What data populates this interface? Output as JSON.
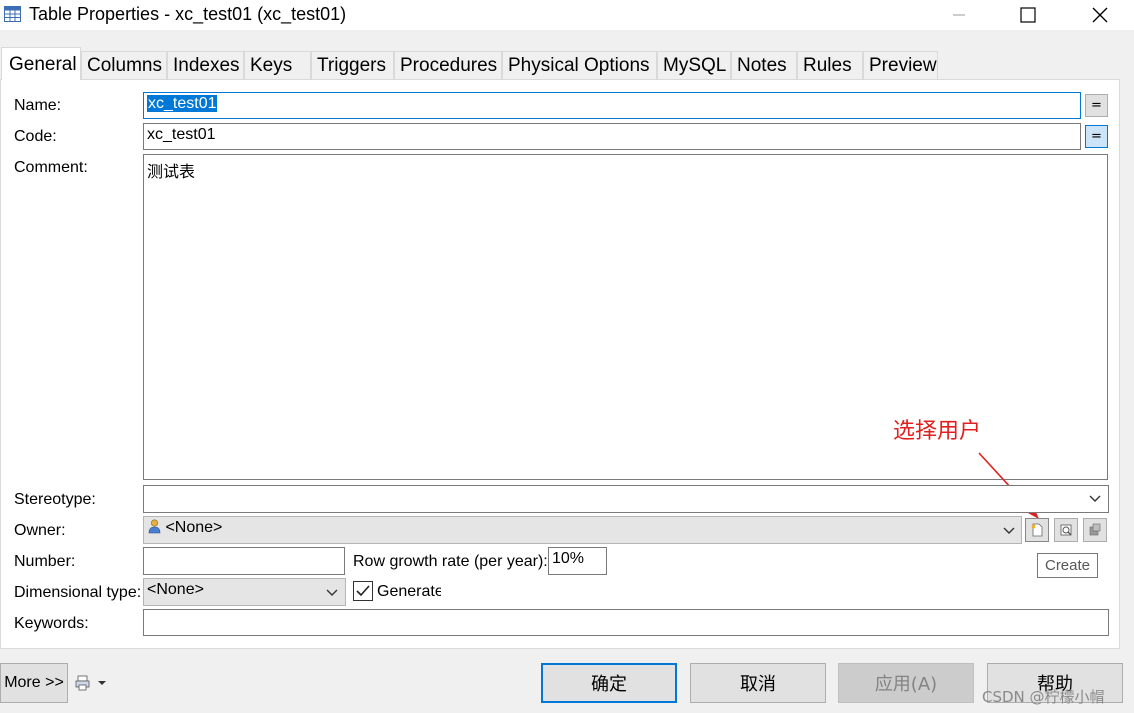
{
  "window": {
    "title": "Table Properties - xc_test01 (xc_test01)"
  },
  "tabs": [
    {
      "label": "General"
    },
    {
      "label": "Columns"
    },
    {
      "label": "Indexes"
    },
    {
      "label": "Keys"
    },
    {
      "label": "Triggers"
    },
    {
      "label": "Procedures"
    },
    {
      "label": "Physical Options"
    },
    {
      "label": "MySQL"
    },
    {
      "label": "Notes"
    },
    {
      "label": "Rules"
    },
    {
      "label": "Preview"
    }
  ],
  "form": {
    "name_label": "Name:",
    "name_value": "xc_test01",
    "code_label": "Code:",
    "code_value": "xc_test01",
    "equals_symbol": "=",
    "comment_label": "Comment:",
    "comment_value": "测试表",
    "stereotype_label": "Stereotype:",
    "stereotype_value": "",
    "owner_label": "Owner:",
    "owner_value": "<None>",
    "number_label": "Number:",
    "number_value": "",
    "row_growth_label": "Row growth rate (per year):",
    "row_growth_value": "10%",
    "dimensional_label": "Dimensional type:",
    "dimensional_value": "<None>",
    "generate_label": "Generate",
    "generate_checked": true,
    "keywords_label": "Keywords:",
    "keywords_value": ""
  },
  "annotation": {
    "text": "选择用户",
    "color": "#e0201f"
  },
  "tooltip": {
    "text": "Create"
  },
  "footer": {
    "more_label": "More >>",
    "ok_label": "确定",
    "cancel_label": "取消",
    "apply_label": "应用(A)",
    "help_label": "帮助",
    "watermark": "CSDN @柠檬小帽"
  },
  "colors": {
    "selection": "#0078d7",
    "accent_border": "#0078d7"
  }
}
